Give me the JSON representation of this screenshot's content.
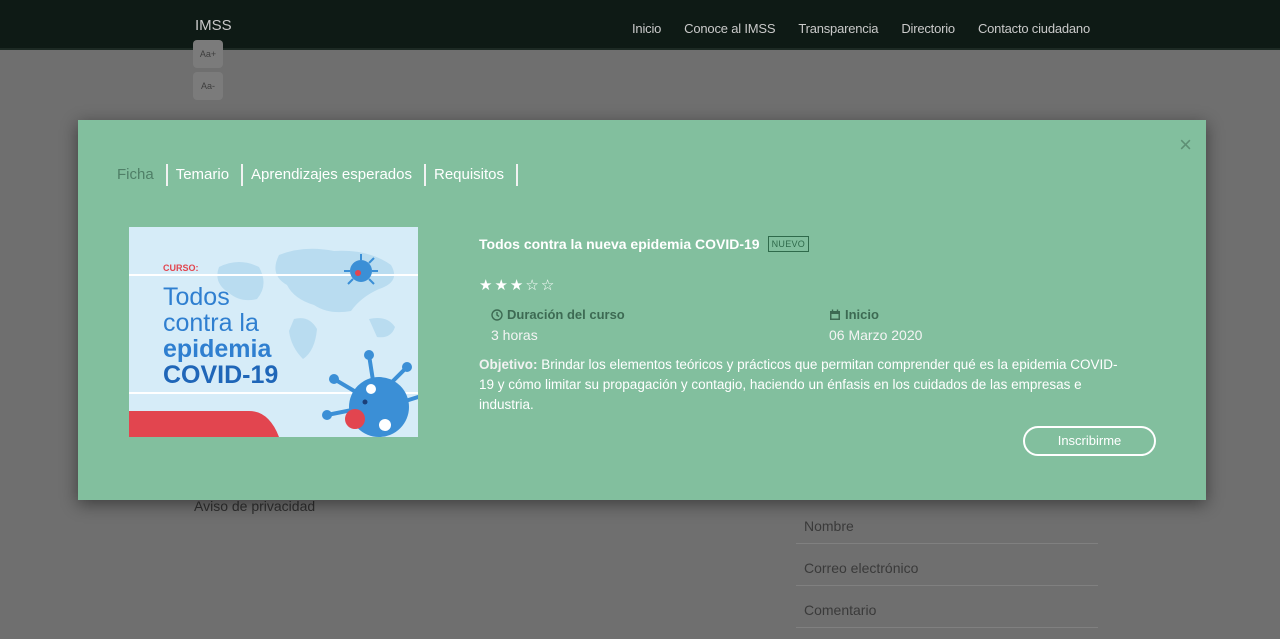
{
  "header": {
    "brand": "IMSS",
    "nav": [
      "Inicio",
      "Conoce al IMSS",
      "Transparencia",
      "Directorio",
      "Contacto ciudadano"
    ]
  },
  "background": {
    "font_increase": "Aa+",
    "font_decrease": "Aa-",
    "privacy_link": "Aviso de privacidad",
    "form_fields": [
      "Nombre",
      "Correo electrónico",
      "Comentario"
    ]
  },
  "modal": {
    "tabs": [
      "Ficha",
      "Temario",
      "Aprendizajes esperados",
      "Requisitos"
    ],
    "close_symbol": "×",
    "course_title": "Todos contra la nueva epidemia COVID-19",
    "badge": "NUEVO",
    "rating": 3,
    "rating_max": 5,
    "duration_label": "Duración del curso",
    "duration_value": "3 horas",
    "start_label": "Inicio",
    "start_value": "06 Marzo 2020",
    "objective_label": "Objetivo:",
    "objective_text": "Brindar los elementos teóricos y prácticos que permitan comprender qué es la epidemia COVID-19 y cómo limitar su propagación y contagio, haciendo un énfasis en los cuidados de las empresas e industria.",
    "enroll_button": "Inscribirme",
    "image": {
      "kicker": "CURSO:",
      "line1": "Todos",
      "line2": "contra la",
      "line3": "epidemia",
      "line4": "COVID-19"
    }
  },
  "colors": {
    "modal_bg": "#82bf9e",
    "navbar_bg": "#0e1a15",
    "overlay": "#6f6f6f",
    "accent_dark_green": "#3d6a53"
  }
}
